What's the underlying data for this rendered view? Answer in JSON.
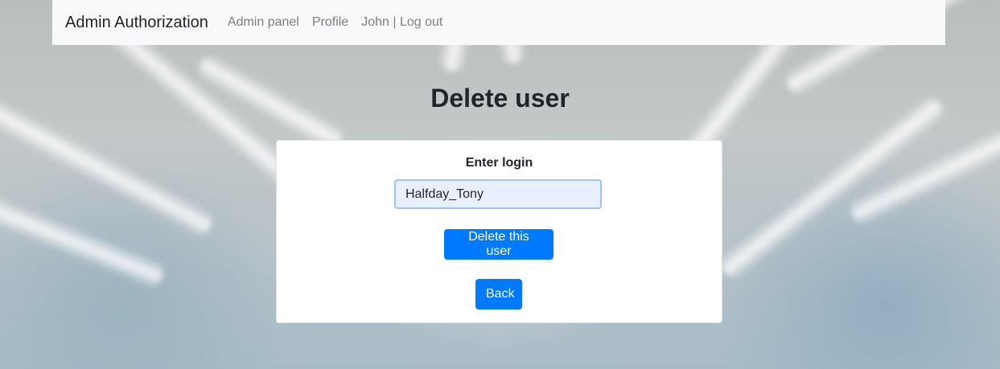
{
  "navbar": {
    "brand": "Admin Authorization",
    "links": [
      "Admin panel",
      "Profile",
      "John | Log out"
    ]
  },
  "page": {
    "title": "Delete user"
  },
  "form": {
    "login_label": "Enter login",
    "login_value": "Halfday_Tony",
    "delete_label": "Delete this user",
    "back_label": "Back"
  },
  "colors": {
    "primary": "#007bff",
    "navbar_bg": "#f8f9fa",
    "input_bg": "#e8f0fe"
  }
}
